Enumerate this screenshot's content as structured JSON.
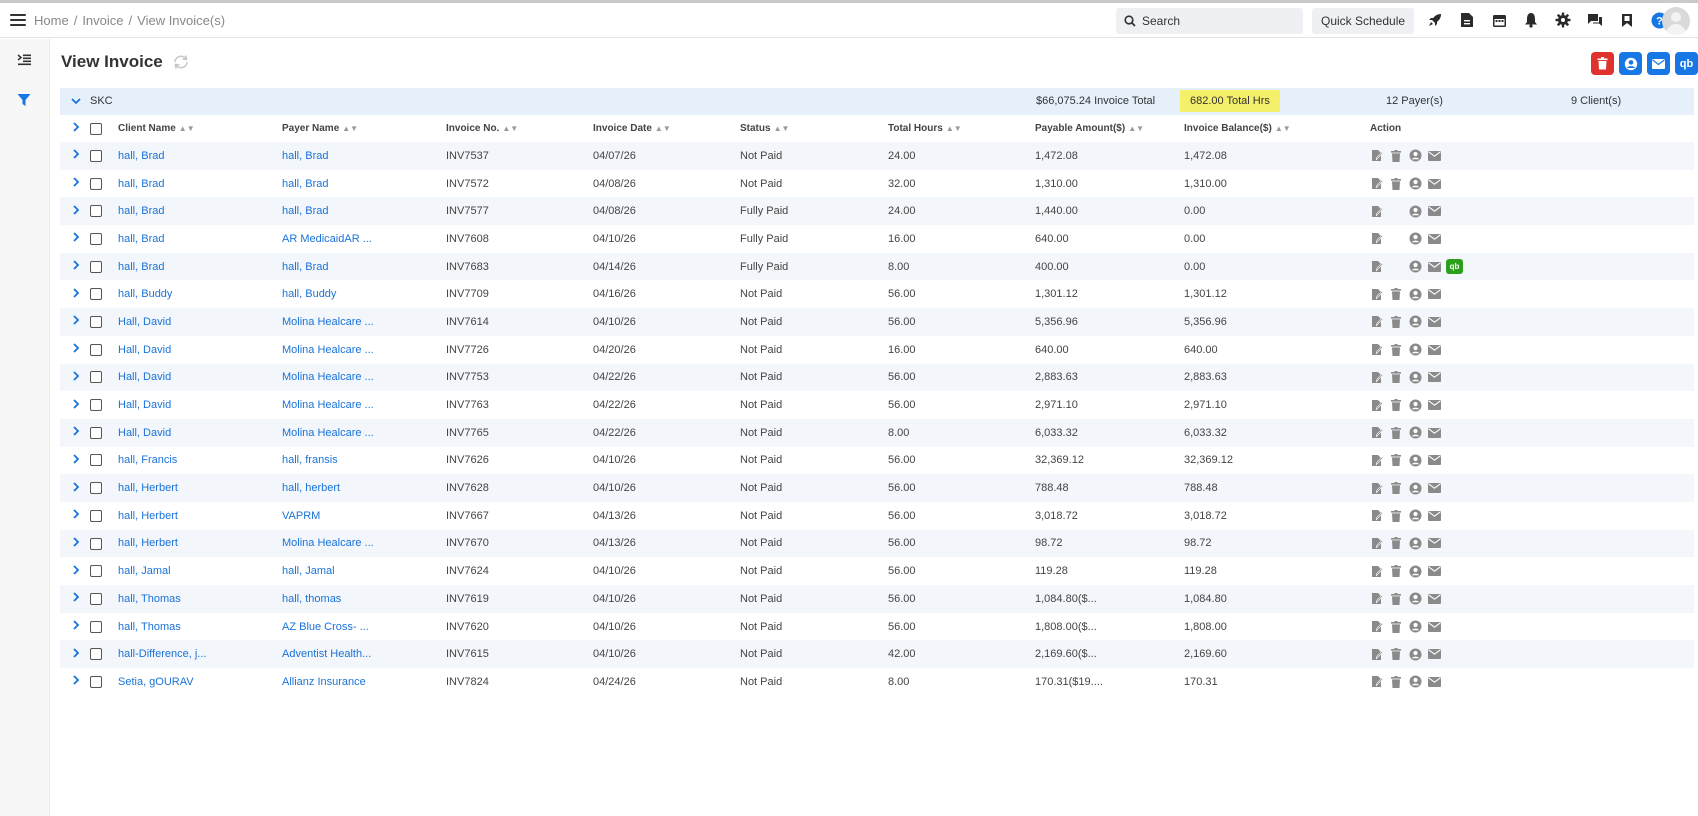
{
  "breadcrumb": [
    "Home",
    "Invoice",
    "View Invoice(s)"
  ],
  "header": {
    "search_label": "Search",
    "quick_schedule_label": "Quick Schedule",
    "icons": [
      "rocket-icon",
      "document-icon",
      "calendar-icon",
      "bell-icon",
      "gear-icon",
      "chat-icon",
      "bookmark-icon",
      "help-icon"
    ]
  },
  "sidebar": {
    "icons": [
      "collapse-menu-icon",
      "filter-icon"
    ]
  },
  "page": {
    "title": "View Invoice",
    "actions": [
      "delete-icon",
      "user-icon",
      "mail-icon",
      "quickbooks-icon"
    ],
    "actions_qb_label": "qb"
  },
  "group": {
    "name": "SKC",
    "invoice_total": "$66,075.24 Invoice Total",
    "total_hours": "682.00 Total Hrs",
    "payers": "12 Payer(s)",
    "clients": "9 Client(s)"
  },
  "table": {
    "columns": [
      "Client Name",
      "Payer Name",
      "Invoice No.",
      "Invoice Date",
      "Status",
      "Total Hours",
      "Payable Amount($)",
      "Invoice Balance($)",
      "Action"
    ],
    "rows": [
      {
        "client": "hall, Brad",
        "payer": "hall, Brad",
        "invoice": "INV7537",
        "date": "04/07/26",
        "status": "Not Paid",
        "hours": "24.00",
        "payable": "1,472.08",
        "balance": "1,472.08",
        "actions": "edit,delete,user,mail"
      },
      {
        "client": "hall, Brad",
        "payer": "hall, Brad",
        "invoice": "INV7572",
        "date": "04/08/26",
        "status": "Not Paid",
        "hours": "32.00",
        "payable": "1,310.00",
        "balance": "1,310.00",
        "actions": "edit,delete,user,mail"
      },
      {
        "client": "hall, Brad",
        "payer": "hall, Brad",
        "invoice": "INV7577",
        "date": "04/08/26",
        "status": "Fully Paid",
        "hours": "24.00",
        "payable": "1,440.00",
        "balance": "0.00",
        "actions": "edit,,user,mail"
      },
      {
        "client": "hall, Brad",
        "payer": "AR MedicaidAR ...",
        "invoice": "INV7608",
        "date": "04/10/26",
        "status": "Fully Paid",
        "hours": "16.00",
        "payable": "640.00",
        "balance": "0.00",
        "actions": "edit,,user,mail"
      },
      {
        "client": "hall, Brad",
        "payer": "hall, Brad",
        "invoice": "INV7683",
        "date": "04/14/26",
        "status": "Fully Paid",
        "hours": "8.00",
        "payable": "400.00",
        "balance": "0.00",
        "actions": "edit,,user,mail,qb"
      },
      {
        "client": "hall, Buddy",
        "payer": "hall, Buddy",
        "invoice": "INV7709",
        "date": "04/16/26",
        "status": "Not Paid",
        "hours": "56.00",
        "payable": "1,301.12",
        "balance": "1,301.12",
        "actions": "edit,delete,user,mail"
      },
      {
        "client": "Hall, David",
        "payer": "Molina Healcare ...",
        "invoice": "INV7614",
        "date": "04/10/26",
        "status": "Not Paid",
        "hours": "56.00",
        "payable": "5,356.96",
        "balance": "5,356.96",
        "actions": "edit,delete,user,mail"
      },
      {
        "client": "Hall, David",
        "payer": "Molina Healcare ...",
        "invoice": "INV7726",
        "date": "04/20/26",
        "status": "Not Paid",
        "hours": "16.00",
        "payable": "640.00",
        "balance": "640.00",
        "actions": "edit,delete,user,mail"
      },
      {
        "client": "Hall, David",
        "payer": "Molina Healcare ...",
        "invoice": "INV7753",
        "date": "04/22/26",
        "status": "Not Paid",
        "hours": "56.00",
        "payable": "2,883.63",
        "balance": "2,883.63",
        "actions": "edit,delete,user,mail"
      },
      {
        "client": "Hall, David",
        "payer": "Molina Healcare ...",
        "invoice": "INV7763",
        "date": "04/22/26",
        "status": "Not Paid",
        "hours": "56.00",
        "payable": "2,971.10",
        "balance": "2,971.10",
        "actions": "edit,delete,user,mail"
      },
      {
        "client": "Hall, David",
        "payer": "Molina Healcare ...",
        "invoice": "INV7765",
        "date": "04/22/26",
        "status": "Not Paid",
        "hours": "8.00",
        "payable": "6,033.32",
        "balance": "6,033.32",
        "actions": "edit,delete,user,mail"
      },
      {
        "client": "hall, Francis",
        "payer": "hall, fransis",
        "invoice": "INV7626",
        "date": "04/10/26",
        "status": "Not Paid",
        "hours": "56.00",
        "payable": "32,369.12",
        "balance": "32,369.12",
        "actions": "edit,delete,user,mail"
      },
      {
        "client": "hall, Herbert",
        "payer": "hall, herbert",
        "invoice": "INV7628",
        "date": "04/10/26",
        "status": "Not Paid",
        "hours": "56.00",
        "payable": "788.48",
        "balance": "788.48",
        "actions": "edit,delete,user,mail"
      },
      {
        "client": "hall, Herbert",
        "payer": "VAPRM",
        "invoice": "INV7667",
        "date": "04/13/26",
        "status": "Not Paid",
        "hours": "56.00",
        "payable": "3,018.72",
        "balance": "3,018.72",
        "actions": "edit,delete,user,mail"
      },
      {
        "client": "hall, Herbert",
        "payer": "Molina Healcare ...",
        "invoice": "INV7670",
        "date": "04/13/26",
        "status": "Not Paid",
        "hours": "56.00",
        "payable": "98.72",
        "balance": "98.72",
        "actions": "edit,delete,user,mail"
      },
      {
        "client": "hall, Jamal",
        "payer": "hall, Jamal",
        "invoice": "INV7624",
        "date": "04/10/26",
        "status": "Not Paid",
        "hours": "56.00",
        "payable": "119.28",
        "balance": "119.28",
        "actions": "edit,delete,user,mail"
      },
      {
        "client": "hall, Thomas",
        "payer": "hall, thomas",
        "invoice": "INV7619",
        "date": "04/10/26",
        "status": "Not Paid",
        "hours": "56.00",
        "payable": "1,084.80($...",
        "balance": "1,084.80",
        "actions": "edit,delete,user,mail"
      },
      {
        "client": "hall, Thomas",
        "payer": "AZ Blue Cross- ...",
        "invoice": "INV7620",
        "date": "04/10/26",
        "status": "Not Paid",
        "hours": "56.00",
        "payable": "1,808.00($...",
        "balance": "1,808.00",
        "actions": "edit,delete,user,mail"
      },
      {
        "client": "hall-Difference, j...",
        "payer": "Adventist Health...",
        "invoice": "INV7615",
        "date": "04/10/26",
        "status": "Not Paid",
        "hours": "42.00",
        "payable": "2,169.60($...",
        "balance": "2,169.60",
        "actions": "edit,delete,user,mail"
      },
      {
        "client": "Setia, gOURAV",
        "payer": "Allianz Insurance",
        "invoice": "INV7824",
        "date": "04/24/26",
        "status": "Not Paid",
        "hours": "8.00",
        "payable": "170.31($19....",
        "balance": "170.31",
        "actions": "edit,delete,user,mail"
      }
    ]
  },
  "colors": {
    "link": "#1a73d9",
    "group_bar": "#e5f0fb",
    "hours_highlight": "#f5f069",
    "stripe": "#f3f6fa",
    "delete_button": "#e0322d",
    "primary_button": "#1677e5",
    "quickbooks": "#2ca01c",
    "filter": "#1677e5"
  }
}
